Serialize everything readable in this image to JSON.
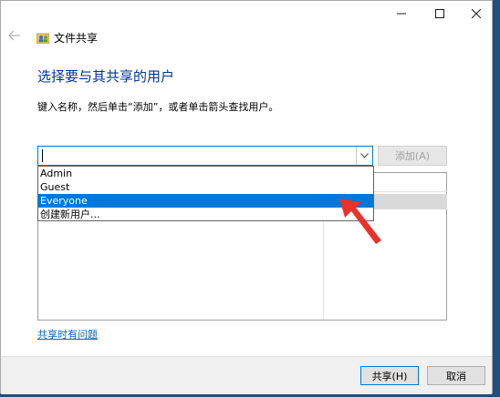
{
  "window": {
    "title": "文件共享",
    "caption_buttons": {
      "minimize_icon": "minimize-icon",
      "maximize_icon": "maximize-icon",
      "close_icon": "close-icon"
    }
  },
  "main": {
    "heading": "选择要与其共享的用户",
    "instruction": "键入名称，然后单击“添加”，或者单击箭头查找用户。",
    "combo_value": "",
    "add_button": "添加(A)"
  },
  "dropdown": {
    "items": [
      "Admin",
      "Guest",
      "Everyone",
      "创建新用户..."
    ],
    "selected": "Everyone"
  },
  "link": {
    "problem": "共享时有问题"
  },
  "footer": {
    "share_button": "共享(H)",
    "cancel_button": "取消"
  },
  "colors": {
    "accent": "#0078d7",
    "heading": "#003399",
    "link": "#0066cc",
    "annotation": "#e8322c",
    "desktop": "#1e4f7d"
  }
}
